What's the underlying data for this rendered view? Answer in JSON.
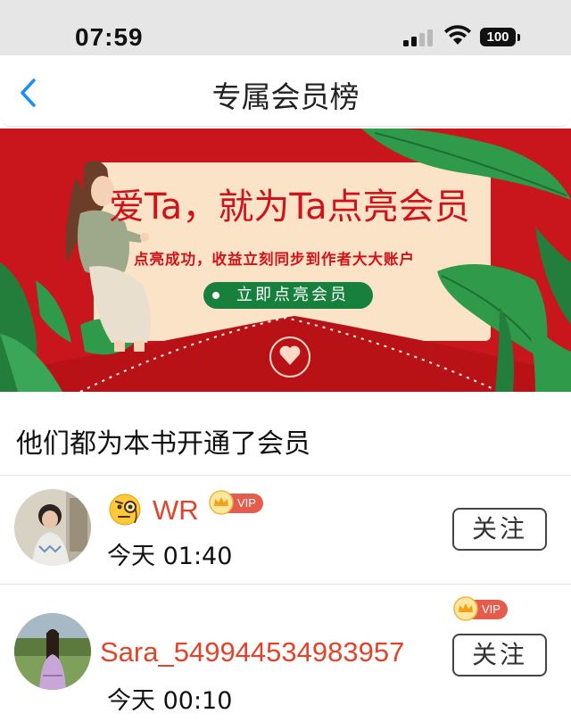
{
  "status_bar": {
    "time": "07:59",
    "battery": "100",
    "icons": [
      "signal-icon",
      "wifi-icon",
      "battery-icon"
    ]
  },
  "nav": {
    "title": "专属会员榜",
    "back_icon": "chevron-left-icon"
  },
  "banner": {
    "title": "爱Ta，就为Ta点亮会员",
    "subtitle": "点亮成功，收益立刻同步到作者大大账户",
    "cta": "立即点亮会员"
  },
  "section": {
    "title": "他们都为本书开通了会员"
  },
  "members": [
    {
      "name": "WR",
      "badge": "VIP",
      "time": "今天 01:40",
      "follow_label": "关注",
      "emoji": "monocle-face-icon"
    },
    {
      "name": "Sara_549944534983957",
      "badge": "VIP",
      "time": "今天 00:10",
      "follow_label": "关注"
    }
  ],
  "colors": {
    "accent_red": "#c9161c",
    "name_red": "#e2442b",
    "vip_badge": "#e45c4b",
    "cta_green": "#17803d",
    "link_blue": "#1a8cff"
  }
}
